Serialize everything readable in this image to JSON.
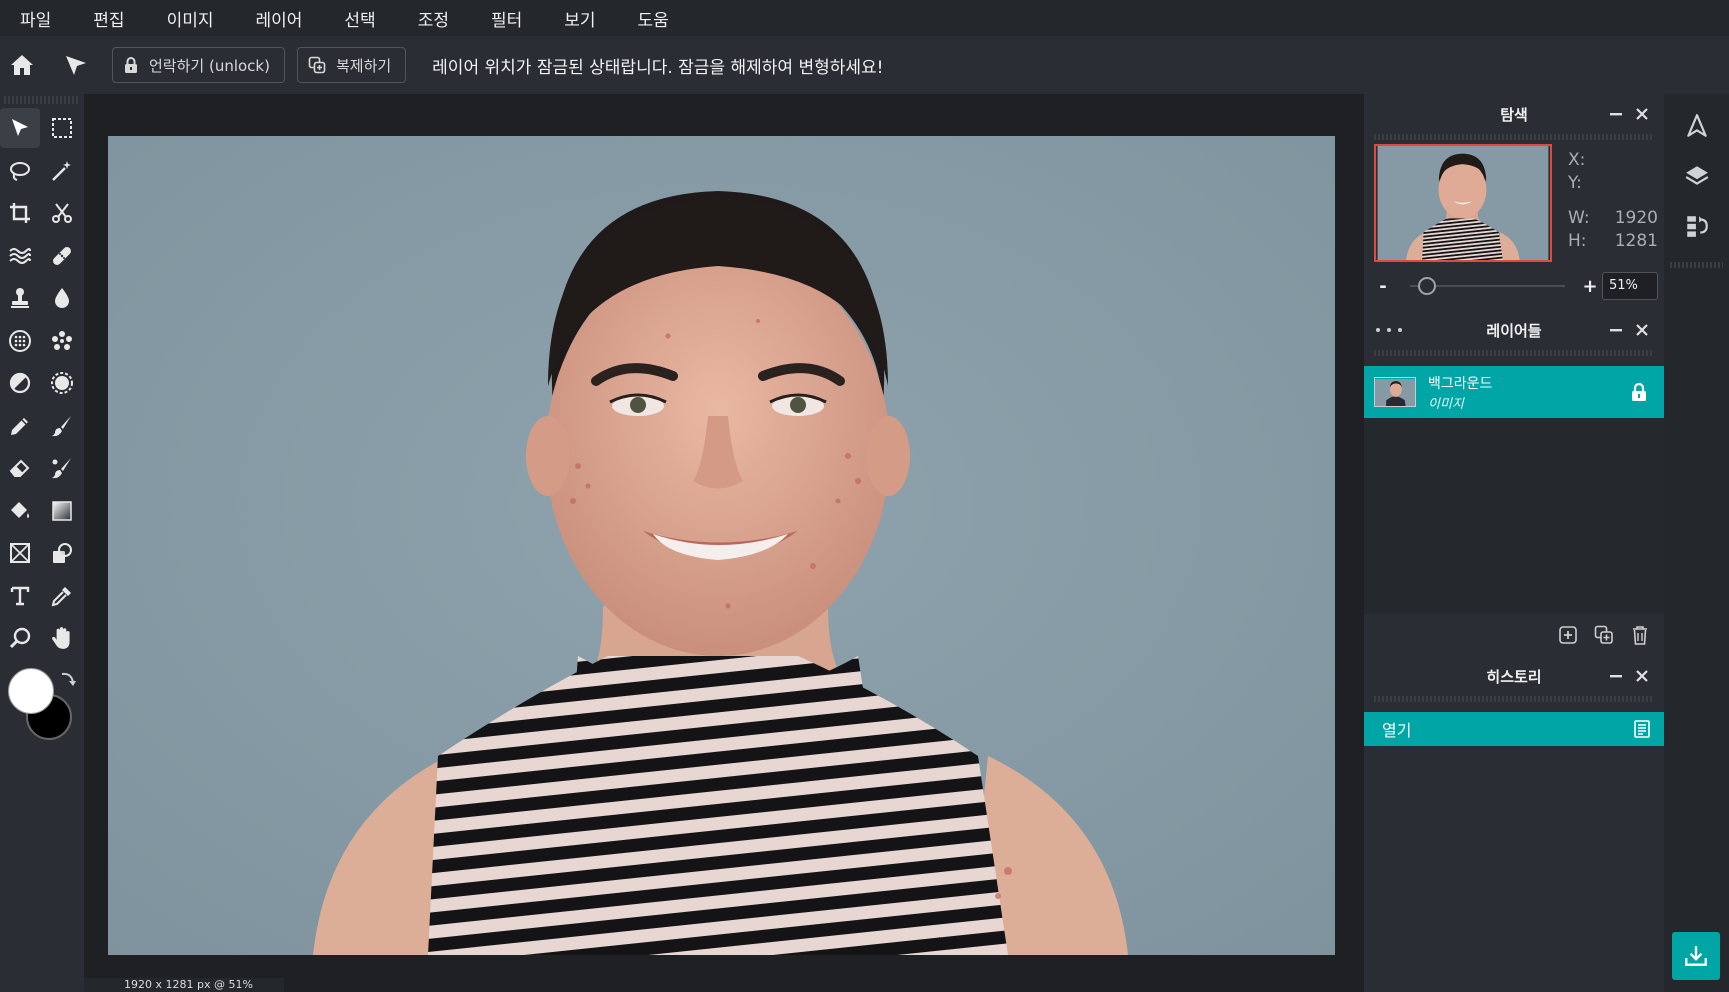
{
  "menu": {
    "items": [
      "파일",
      "편집",
      "이미지",
      "레이어",
      "선택",
      "조정",
      "필터",
      "보기",
      "도움"
    ]
  },
  "options": {
    "unlock_label": "언락하기 (unlock)",
    "duplicate_label": "복제하기",
    "lock_message": "레이어 위치가 잠금된 상태랍니다. 잠금을 해제하여 변형하세요!"
  },
  "toolbar": {
    "tools": [
      {
        "name": "move-tool-icon",
        "active": true
      },
      {
        "name": "marquee-select-icon"
      },
      {
        "name": "lasso-icon"
      },
      {
        "name": "magic-wand-icon"
      },
      {
        "name": "crop-icon"
      },
      {
        "name": "scissors-icon"
      },
      {
        "name": "liquify-icon"
      },
      {
        "name": "healing-bandage-icon"
      },
      {
        "name": "clone-stamp-icon"
      },
      {
        "name": "blur-drop-icon"
      },
      {
        "name": "sponge-icon"
      },
      {
        "name": "particle-brush-icon"
      },
      {
        "name": "dodge-burn-icon"
      },
      {
        "name": "sharpen-icon"
      },
      {
        "name": "pencil-icon"
      },
      {
        "name": "brush-icon"
      },
      {
        "name": "eraser-icon"
      },
      {
        "name": "color-replace-icon"
      },
      {
        "name": "paint-bucket-icon"
      },
      {
        "name": "gradient-icon"
      },
      {
        "name": "frame-icon"
      },
      {
        "name": "shape-icon"
      },
      {
        "name": "text-tool-icon"
      },
      {
        "name": "eyedropper-icon"
      },
      {
        "name": "zoom-tool-icon"
      },
      {
        "name": "hand-tool-icon"
      }
    ],
    "foreground_color": "#ffffff",
    "background_color": "#000000"
  },
  "canvas": {
    "status": "1920 x 1281 px @ 51%"
  },
  "navigator": {
    "title": "탐색",
    "x_label": "X:",
    "y_label": "Y:",
    "w_label": "W:",
    "w_value": "1920",
    "h_label": "H:",
    "h_value": "1281",
    "zoom_minus": "-",
    "zoom_plus": "+",
    "zoom_value": "51%",
    "zoom_level": 0.05
  },
  "layers": {
    "title": "레이어들",
    "items": [
      {
        "name": "백그라운드",
        "type": "이미지",
        "locked": true
      }
    ]
  },
  "history": {
    "title": "히스토리",
    "items": [
      {
        "label": "열기"
      }
    ]
  },
  "colors": {
    "accent": "#00a5a5",
    "panel_bg": "#2a2d33",
    "app_bg": "#1e2024",
    "nav_viewport": "#e04a3a"
  }
}
